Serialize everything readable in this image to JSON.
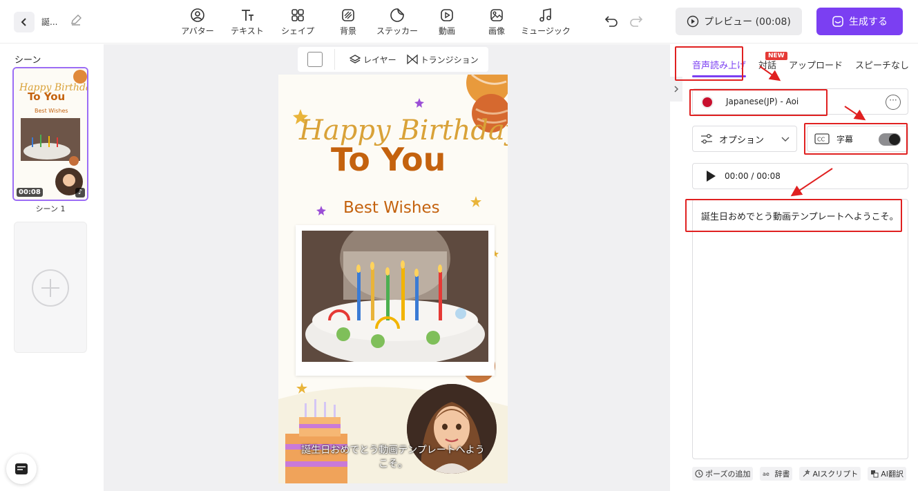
{
  "header": {
    "project_name": "誕...",
    "tools": [
      {
        "label": "アバター",
        "icon": "avatar-icon"
      },
      {
        "label": "テキスト",
        "icon": "text-icon"
      },
      {
        "label": "シェイプ",
        "icon": "shape-icon"
      },
      {
        "label": "背景",
        "icon": "background-icon"
      },
      {
        "label": "ステッカー",
        "icon": "sticker-icon"
      },
      {
        "label": "動画",
        "icon": "video-icon"
      },
      {
        "label": "画像",
        "icon": "image-icon"
      },
      {
        "label": "ミュージック",
        "icon": "music-icon"
      }
    ],
    "preview_label": "プレビュー (00:08)",
    "generate_label": "生成する"
  },
  "scenes": {
    "title": "シーン",
    "items": [
      {
        "label": "シーン 1",
        "duration": "00:08"
      }
    ]
  },
  "canvas": {
    "toolbar": {
      "layer_label": "レイヤー",
      "transition_label": "トランジション"
    },
    "poster": {
      "line1": "Happy Birthday",
      "line2": "To You",
      "wishes": "Best Wishes",
      "subtitle": "誕生日おめでとう動画テンプレートへようこそ。"
    }
  },
  "right_panel": {
    "tabs": [
      {
        "label": "音声読み上げ",
        "active": true
      },
      {
        "label": "対話",
        "badge": "NEW"
      },
      {
        "label": "アップロード"
      },
      {
        "label": "スピーチなし"
      }
    ],
    "voice": "Japanese(JP) - Aoi",
    "options_label": "オプション",
    "subtitles_label": "字幕",
    "subtitles_on": true,
    "player_time": "00:00 / 00:08",
    "script": "誕生日おめでとう動画テンプレートへようこそ。",
    "bottom_tools": [
      {
        "label": "ポーズの追加",
        "icon": "clock-icon"
      },
      {
        "label": "辞書",
        "icon": "dictionary-icon"
      },
      {
        "label": "AIスクリプト",
        "icon": "ai-script-icon"
      },
      {
        "label": "AI翻訳",
        "icon": "translate-icon"
      }
    ]
  },
  "colors": {
    "accent": "#7b3ff2",
    "highlight": "#e02020",
    "poster_orange": "#c4620e",
    "poster_gold": "#d9a238"
  }
}
